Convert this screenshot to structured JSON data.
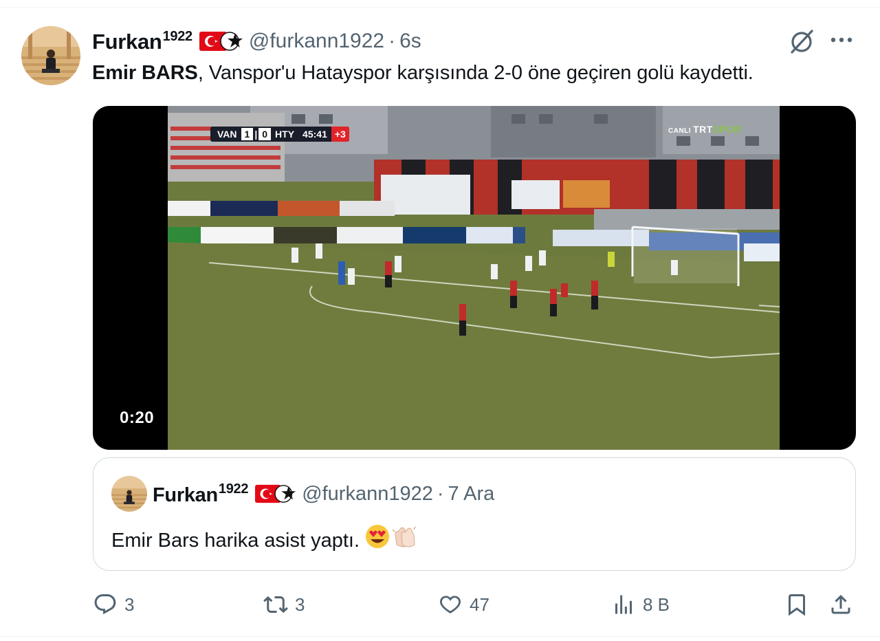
{
  "tweet": {
    "author": {
      "name": "Furkan",
      "name_sup": "1922",
      "handle": "@furkann1922"
    },
    "separator": "·",
    "time": "6s",
    "text": {
      "bold": "Emir BARS",
      "rest": ", Vanspor'u Hatayspor karşısında 2-0 öne geçiren golü kaydetti."
    },
    "video": {
      "duration": "0:20",
      "scorebar": {
        "home": "VAN",
        "score_home": "1",
        "score_sep": "|",
        "score_away": "0",
        "away": "HTY",
        "clock": "45:41",
        "added": "+3"
      },
      "broadcaster": {
        "prefix": "CANLI",
        "name_a": "TRT",
        "name_b": "SPOR"
      }
    }
  },
  "quoted": {
    "author": {
      "name": "Furkan",
      "name_sup": "1922",
      "handle": "@furkann1922"
    },
    "separator": "·",
    "time": "7 Ara",
    "text": "Emir Bars harika asist yaptı."
  },
  "actions": {
    "replies": "3",
    "reposts": "3",
    "likes": "47",
    "views": "8 B"
  },
  "colors": {
    "text": "#0f1419",
    "secondary": "#536471",
    "border": "#cfd9de",
    "flag_red": "#e30a17"
  },
  "icons": [
    "grok-icon",
    "more-icon",
    "reply-icon",
    "repost-icon",
    "like-icon",
    "views-icon",
    "bookmark-icon",
    "share-icon"
  ]
}
